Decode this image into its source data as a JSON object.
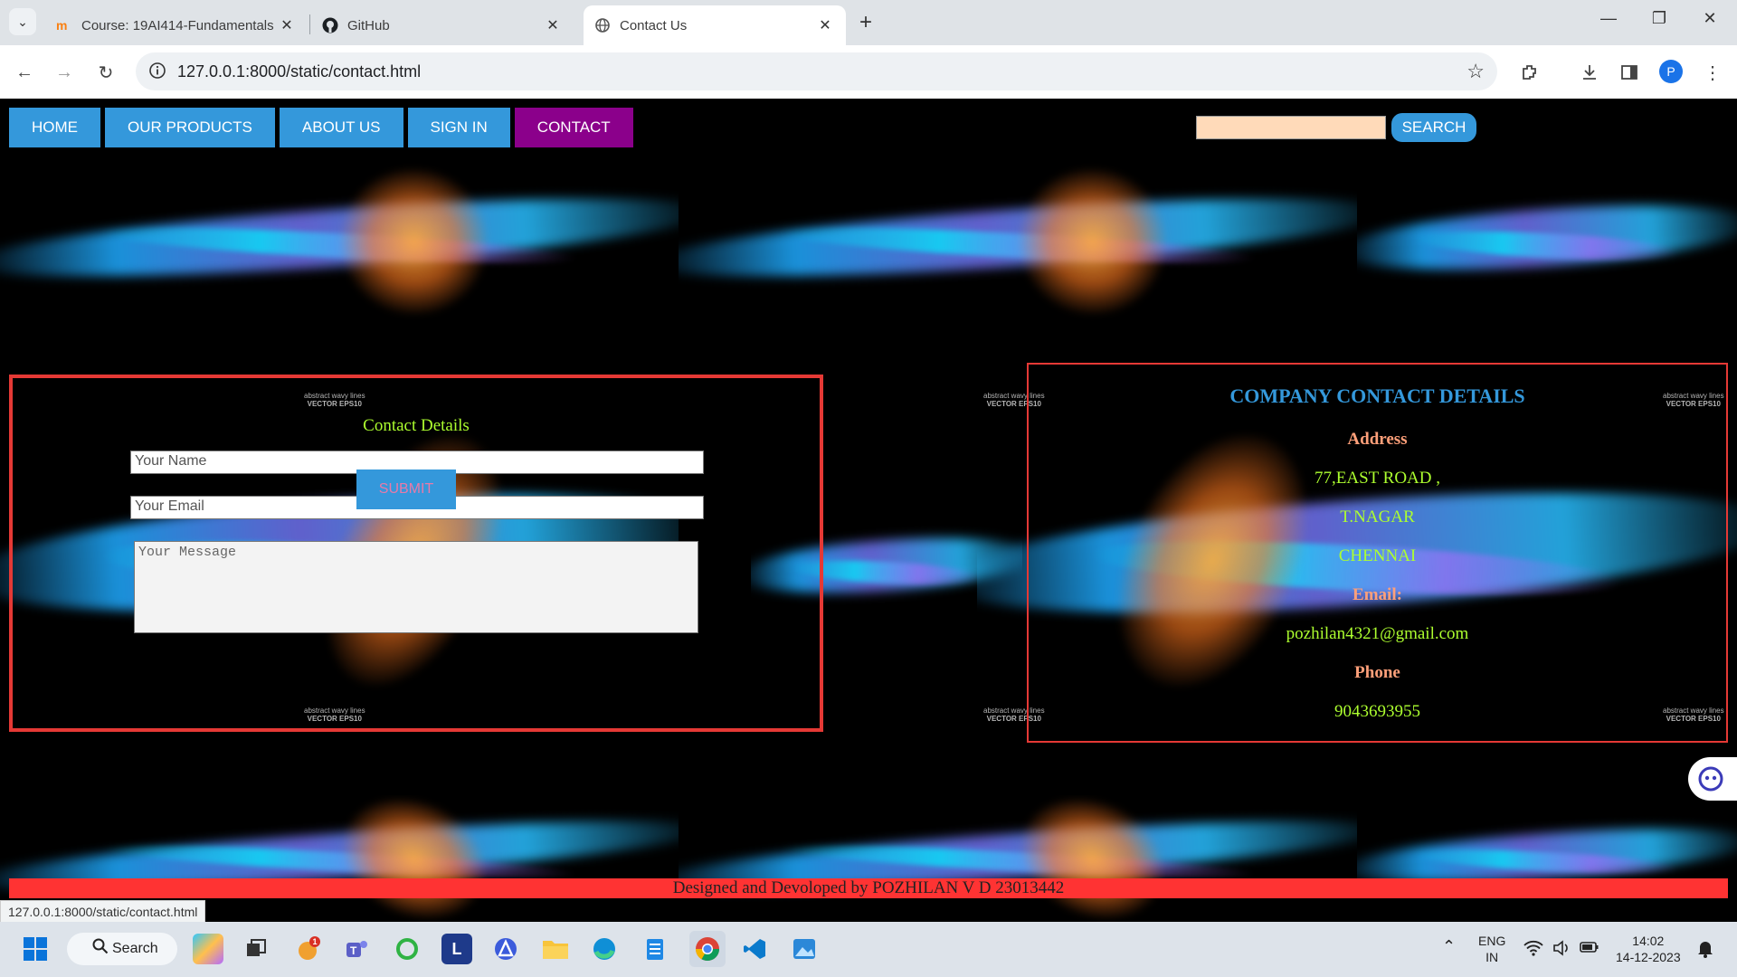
{
  "browser": {
    "tabs": [
      {
        "title": "Course: 19AI414-Fundamentals",
        "icon": "moodle-icon",
        "active": false
      },
      {
        "title": "GitHub",
        "icon": "github-icon",
        "active": false
      },
      {
        "title": "Contact Us",
        "icon": "globe-icon",
        "active": true
      }
    ],
    "new_tab": "+",
    "url": "127.0.0.1:8000/static/contact.html",
    "profile_initial": "P",
    "status_url": "127.0.0.1:8000/static/contact.html"
  },
  "nav": {
    "items": [
      "HOME",
      "OUR PRODUCTS",
      "ABOUT US",
      "SIGN IN",
      "CONTACT"
    ],
    "active": "CONTACT",
    "search_value": "",
    "search_button": "SEARCH"
  },
  "background": {
    "watermark_line1": "abstract wavy lines",
    "watermark_line2": "VECTOR EPS10"
  },
  "contact_form": {
    "heading": "Contact Details",
    "name_placeholder": "Your Name",
    "email_placeholder": "Your Email",
    "message_placeholder": "Your Message",
    "submit_label": "SUBMIT"
  },
  "company": {
    "title": "COMPANY CONTACT DETAILS",
    "address_label": "Address",
    "address_lines": [
      "77,EAST ROAD ,",
      "T.NAGAR",
      "CHENNAI"
    ],
    "email_label": "Email:",
    "email": "pozhilan4321@gmail.com",
    "phone_label": "Phone",
    "phone": "9043693955"
  },
  "footer": {
    "text": "Designed and Devoloped by POZHILAN V D 23013442"
  },
  "taskbar": {
    "search_label": "Search",
    "notification_badge": "1",
    "lang_line1": "ENG",
    "lang_line2": "IN",
    "time": "14:02",
    "date": "14-12-2023"
  },
  "colors": {
    "nav_button": "#3498db",
    "nav_active": "#8b008b",
    "border_red": "#e53935",
    "heading_green": "#adff2f",
    "label_salmon": "#ffa07a",
    "footer_red": "#ff3333",
    "search_box": "#ffdab9"
  }
}
